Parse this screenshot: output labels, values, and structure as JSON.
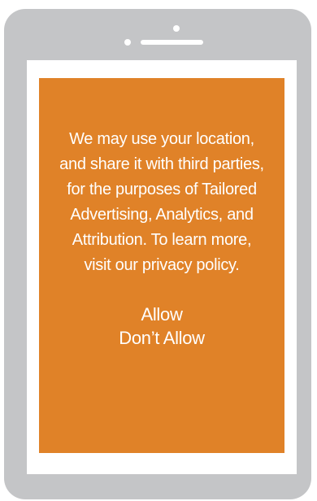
{
  "dialog": {
    "message_lines": [
      "We may use your location,",
      "and share it with third parties,",
      "for the purposes of Tailored",
      "Advertising, Analytics, and",
      "Attribution. To learn more,",
      "visit our privacy policy."
    ],
    "allow_label": "Allow",
    "dont_allow_label": "Don’t Allow"
  },
  "colors": {
    "device_frame": "#c4c5c7",
    "dialog_background": "#e08228",
    "text": "#ffffff"
  }
}
